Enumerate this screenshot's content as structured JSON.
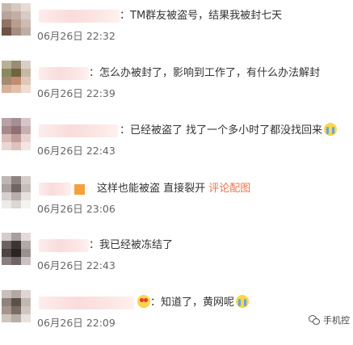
{
  "colors": {
    "text": "#333333",
    "time": "#666666",
    "link": "#eb7350",
    "name_blur": "#f9dada"
  },
  "comments": [
    {
      "text": "：TM群友被盗号，结果我被封七天",
      "date": "06月26日",
      "time": "22:32"
    },
    {
      "text": "：怎么办被封了，影响到工作了，有什么办法解封",
      "date": "06月26日",
      "time": "22:39"
    },
    {
      "text": "：已经被盗了 找了一个多小时了都没找回来",
      "emoji": "crying-face-icon",
      "date": "06月26日",
      "time": "22:43"
    },
    {
      "text": "这样也能被盗 直接裂开",
      "link": "评论配图",
      "date": "06月26日",
      "time": "23:06"
    },
    {
      "text": "：我已经被冻结了",
      "date": "06月26日",
      "time": "22:43"
    },
    {
      "text": "：知道了，黄网呢",
      "emoji_before": "heart-eyes-icon",
      "emoji": "crying-face-icon",
      "date": "06月26日",
      "time": "22:09"
    }
  ],
  "watermark": {
    "icon": "wechat-icon",
    "label": "手机控"
  }
}
